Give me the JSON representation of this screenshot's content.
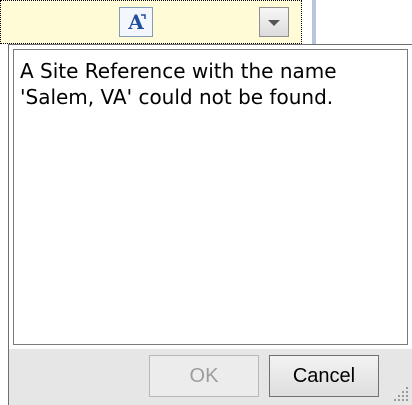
{
  "popup": {
    "message": "A Site Reference with the name 'Salem, VA' could not be found.",
    "ok_label": "OK",
    "cancel_label": "Cancel"
  },
  "icons": {
    "font_icon": "font-a-icon",
    "dropdown_icon": "chevron-down-icon",
    "resize_icon": "resize-grip-icon"
  }
}
